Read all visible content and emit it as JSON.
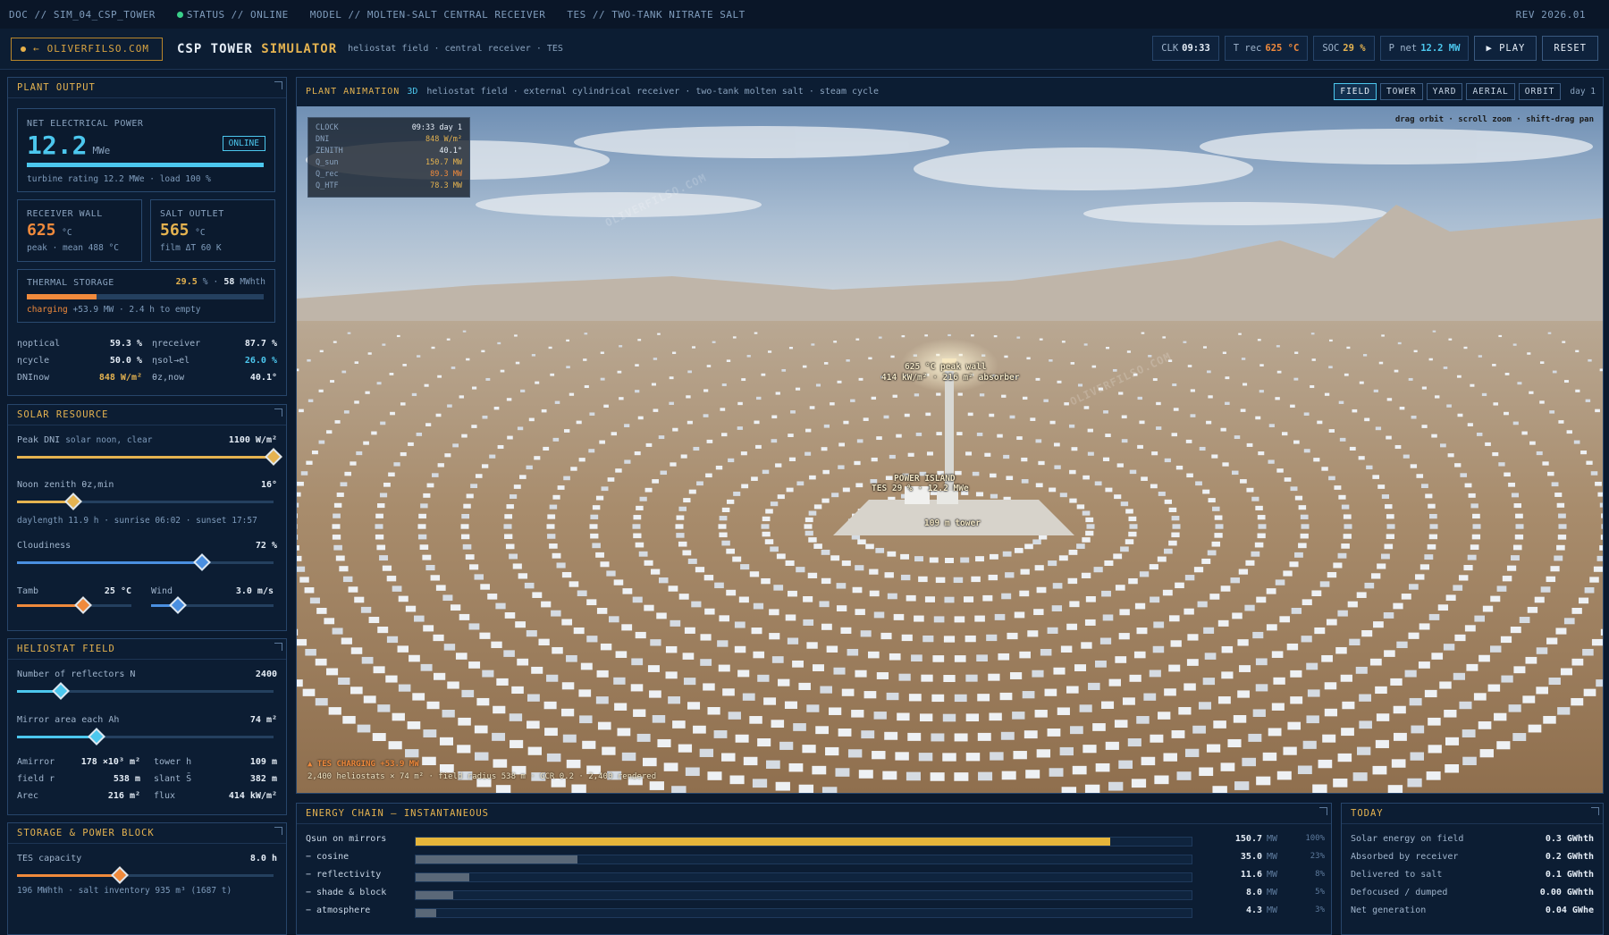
{
  "topbar": {
    "doc": "DOC // SIM_04_CSP_TOWER",
    "status": "STATUS // ONLINE",
    "model": "MODEL // MOLTEN-SALT CENTRAL RECEIVER",
    "tes": "TES // TWO-TANK NITRATE SALT",
    "rev": "REV 2026.01"
  },
  "header": {
    "brand": "OLIVERFILSO.COM",
    "title_a": "CSP TOWER",
    "title_b": "SIMULATOR",
    "subtitle": "heliostat field · central receiver · TES",
    "clk_label": "CLK",
    "clk": "09:33",
    "trec_label": "T rec",
    "trec": "625 °C",
    "soc_label": "SOC",
    "soc": "29 %",
    "pnet_label": "P net",
    "pnet": "12.2 MW",
    "play": "▶ PLAY",
    "reset": "RESET"
  },
  "plant_output": {
    "title": "PLANT OUTPUT",
    "net_label": "NET ELECTRICAL POWER",
    "net_value": "12.2",
    "net_unit": "MWe",
    "online": "ONLINE",
    "turbine_note": "turbine rating 12.2 MWe · load 100 %",
    "load_fraction": 1.0,
    "receiver_label": "RECEIVER WALL",
    "receiver_value": "625",
    "receiver_unit": "°C",
    "receiver_note": "peak · mean 488 °C",
    "salt_label": "SALT OUTLET",
    "salt_value": "565",
    "salt_unit": "°C",
    "salt_note": "film ΔT 60 K",
    "storage_label": "THERMAL STORAGE",
    "storage_pct": "29.5",
    "storage_pct_unit": "%",
    "storage_mwh": "58",
    "storage_mwh_unit": "MWhth",
    "storage_fraction": 0.295,
    "storage_charging": "charging",
    "storage_note": "+53.9 MW · 2.4 h to empty",
    "eta_optical_label": "ηoptical",
    "eta_optical": "59.3 %",
    "eta_receiver_label": "ηreceiver",
    "eta_receiver": "87.7 %",
    "eta_cycle_label": "ηcycle",
    "eta_cycle": "50.0 %",
    "eta_sol_label": "ηsol→el",
    "eta_sol": "26.0 %",
    "dni_label": "DNInow",
    "dni": "848 W/m²",
    "theta_label": "θz,now",
    "theta": "40.1°"
  },
  "solar": {
    "title": "SOLAR RESOURCE",
    "peak_dni_label": "Peak DNI",
    "peak_dni_sub": "solar noon, clear",
    "peak_dni": "1100 W/m²",
    "peak_dni_frac": 1.0,
    "zenith_label": "Noon zenith θz,min",
    "zenith": "16°",
    "zenith_frac": 0.22,
    "daylight": "daylength 11.9 h · sunrise 06:02 · sunset 17:57",
    "cloud_label": "Cloudiness",
    "cloud": "72 %",
    "cloud_frac": 0.72,
    "tamb_label": "Tamb",
    "tamb": "25 °C",
    "tamb_frac": 0.58,
    "wind_label": "Wind",
    "wind": "3.0 m/s",
    "wind_frac": 0.22
  },
  "heliostat": {
    "title": "HELIOSTAT FIELD",
    "n_label": "Number of reflectors N",
    "n": "2400",
    "n_frac": 0.17,
    "area_label": "Mirror area each Ah",
    "area": "74 m²",
    "area_frac": 0.31,
    "amirror_label": "Amirror",
    "amirror": "178 ×10³ m²",
    "tower_label": "tower h",
    "tower": "109 m",
    "fieldr_label": "field r",
    "fieldr": "538 m",
    "slant_label": "slant S̄",
    "slant": "382 m",
    "arec_label": "Arec",
    "arec": "216 m²",
    "flux_label": "flux",
    "flux": "414 kW/m²"
  },
  "storage": {
    "title": "STORAGE & POWER BLOCK",
    "tes_label": "TES capacity",
    "tes": "8.0 h",
    "tes_frac": 0.4,
    "note": "196 MWhth · salt inventory 935 m³ (1687 t)"
  },
  "viewport": {
    "title": "PLANT ANIMATION",
    "dim": "3D",
    "subtitle": "heliostat field · external cylindrical receiver · two-tank molten salt · steam cycle",
    "cams": [
      "FIELD",
      "TOWER",
      "YARD",
      "AERIAL",
      "ORBIT"
    ],
    "day": "day 1",
    "hint": "drag orbit · scroll zoom · shift-drag pan",
    "hud": {
      "clock_label": "CLOCK",
      "clock": "09:33",
      "day": "day 1",
      "dni_label": "DNI",
      "dni": "848 W/m²",
      "zenith_label": "ZENITH",
      "zenith": "40.1°",
      "qsun_label": "Q_sun",
      "qsun": "150.7 MW",
      "qrec_label": "Q_rec",
      "qrec": "89.3 MW",
      "qhtf_label": "Q_HTF",
      "qhtf": "78.3 MW"
    },
    "tag_peak": "625 °C peak wall",
    "tag_flux": "414 kW/m² · 216 m² absorber",
    "tag_island": "POWER ISLAND",
    "tag_island2": "TES 29 % · 12.2 MWe",
    "tag_tower": "109 m tower",
    "tes_status": "▲ TES CHARGING +53.9 MW",
    "footer": "2,400 heliostats × 74 m² · field radius 538 m · GCR 0.2 · 2,400 rendered",
    "watermark": "OLIVERFILSO.COM"
  },
  "energy_chain": {
    "title": "ENERGY CHAIN — INSTANTANEOUS",
    "rows": [
      {
        "name": "Qsun on mirrors",
        "value": "150.7",
        "unit": "MW",
        "pct": "100%",
        "frac": 0.895,
        "color": "#e5b53a"
      },
      {
        "name": "− cosine",
        "value": "35.0",
        "unit": "MW",
        "pct": "23%",
        "frac": 0.208,
        "color": "#5a6878"
      },
      {
        "name": "− reflectivity",
        "value": "11.6",
        "unit": "MW",
        "pct": "8%",
        "frac": 0.069,
        "color": "#5a6878"
      },
      {
        "name": "− shade & block",
        "value": "8.0",
        "unit": "MW",
        "pct": "5%",
        "frac": 0.048,
        "color": "#5a6878"
      },
      {
        "name": "− atmosphere",
        "value": "4.3",
        "unit": "MW",
        "pct": "3%",
        "frac": 0.026,
        "color": "#5a6878"
      }
    ]
  },
  "today": {
    "title": "TODAY",
    "rows": [
      {
        "k": "Solar energy on field",
        "v": "0.3 GWhth"
      },
      {
        "k": "Absorbed by receiver",
        "v": "0.2 GWhth"
      },
      {
        "k": "Delivered to salt",
        "v": "0.1 GWhth"
      },
      {
        "k": "Defocused / dumped",
        "v": "0.00 GWhth"
      },
      {
        "k": "Net generation",
        "v": "0.04 GWhe"
      }
    ]
  }
}
